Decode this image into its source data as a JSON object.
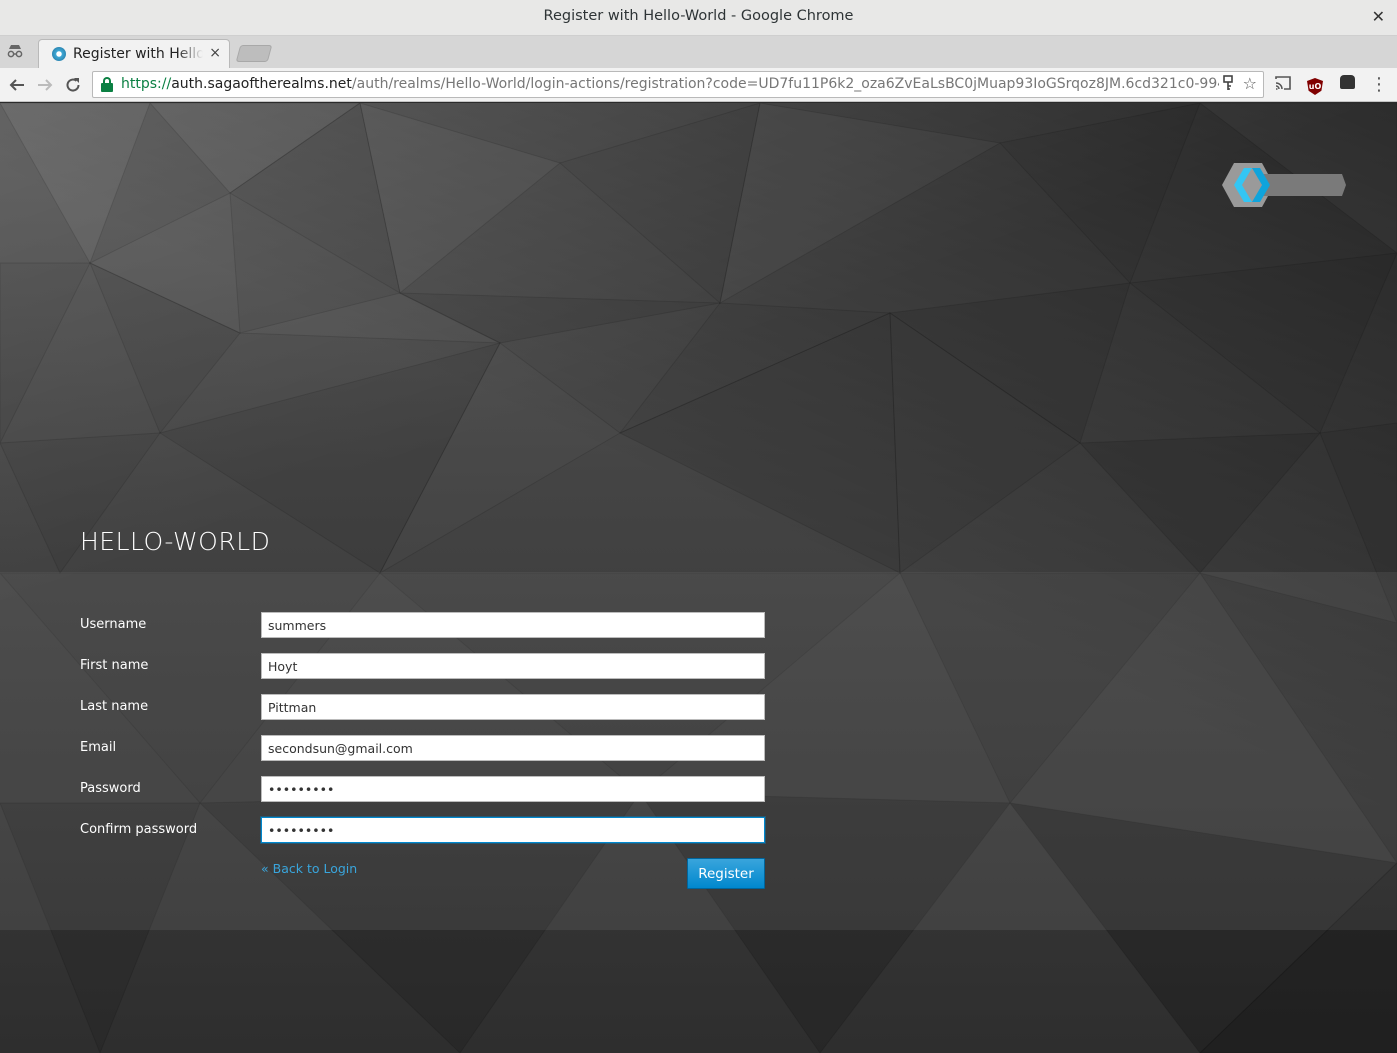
{
  "window": {
    "title": "Register with Hello-World - Google Chrome"
  },
  "tab": {
    "title": "Register with Hello-World",
    "close": "×"
  },
  "toolbar": {
    "url_scheme": "https://",
    "url_host": "auth.sagaoftherealms.net",
    "url_path": "/auth/realms/Hello-World/login-actions/registration?code=UD7fu11P6k2_oza6ZvEaLsBC0jMuap93IoGSrqoz8JM.6cd321c0-9940-4b9c-b169-8"
  },
  "page": {
    "realm_title": "HELLO-WORLD",
    "form": {
      "fields": [
        {
          "label": "Username",
          "value": "summers",
          "type": "text"
        },
        {
          "label": "First name",
          "value": "Hoyt",
          "type": "text"
        },
        {
          "label": "Last name",
          "value": "Pittman",
          "type": "text"
        },
        {
          "label": "Email",
          "value": "secondsun@gmail.com",
          "type": "text"
        },
        {
          "label": "Password",
          "value": "•••••••••",
          "type": "password"
        },
        {
          "label": "Confirm password",
          "value": "•••••••••",
          "type": "password",
          "focused": true
        }
      ],
      "back_link": "« Back to Login",
      "submit_label": "Register"
    }
  },
  "colors": {
    "accent": "#0088ce",
    "link": "#39a5dc",
    "secure_green": "#0b8043"
  },
  "icons": [
    "incognito-icon",
    "favicon-icon",
    "back-icon",
    "forward-icon",
    "reload-icon",
    "lock-icon",
    "key-icon",
    "star-icon",
    "cast-icon",
    "ublock-icon",
    "ghostery-icon",
    "menu-icon",
    "keycloak-logo"
  ]
}
